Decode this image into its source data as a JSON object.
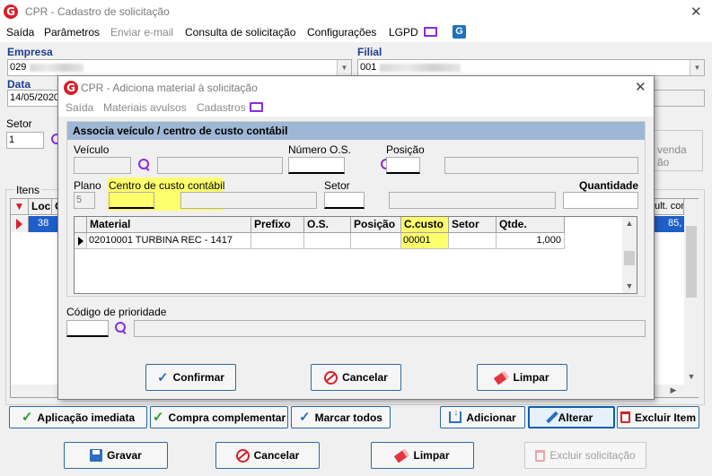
{
  "window": {
    "title": "CPR - Cadastro de solicitação",
    "close": "✕"
  },
  "menu": {
    "items": [
      {
        "label": "Saída"
      },
      {
        "label": "Parâmetros"
      },
      {
        "label": "Enviar e-mail"
      },
      {
        "label": "Consulta de solicitação"
      },
      {
        "label": "Configurações"
      },
      {
        "label": "LGPD"
      }
    ]
  },
  "main": {
    "empresa_label": "Empresa",
    "empresa_value": "029",
    "filial_label": "Filial",
    "filial_value": "001",
    "data_label": "Data",
    "data_value": "14/05/2020",
    "setor_label": "Setor",
    "setor_value": "1",
    "itens_label": "Itens",
    "grid_headers": [
      "Loc",
      "G",
      "ult. com"
    ],
    "grid_row": {
      "loc": "38",
      "ult": "85,"
    },
    "side_text_1": "venda",
    "side_text_2": "ão"
  },
  "dialog": {
    "title": "CPR - Adiciona material à solicitação",
    "close": "✕",
    "menu": [
      "Saída",
      "Materiais avulsos",
      "Cadastros"
    ],
    "section_title": "Associa veículo / centro de custo contábil",
    "veiculo_label": "Veículo",
    "numero_os_label": "Número O.S.",
    "posicao_label": "Posição",
    "plano_label": "Plano",
    "plano_value": "5",
    "centro_custo_label": "Centro de custo contábil",
    "setor_label": "Setor",
    "quantidade_label": "Quantidade",
    "grid": {
      "headers": [
        "Material",
        "Prefixo",
        "O.S.",
        "Posição",
        "C.custo",
        "Setor",
        "Qtde."
      ],
      "rows": [
        {
          "material": "02010001 TURBINA REC - 1417",
          "prefixo": "",
          "os": "",
          "posicao": "",
          "ccusto": "00001",
          "setor": "",
          "qtde": "1,000"
        }
      ]
    },
    "prioridade_label": "Código de prioridade",
    "buttons": {
      "confirmar": "Confirmar",
      "cancelar": "Cancelar",
      "limpar": "Limpar"
    }
  },
  "bottom_row1": {
    "aplicacao": "Aplicação imediata",
    "compra": "Compra complementar",
    "marcar": "Marcar todos",
    "adicionar": "Adicionar",
    "alterar": "Alterar",
    "excluir_item": "Excluir Item"
  },
  "bottom_row2": {
    "gravar": "Gravar",
    "cancelar": "Cancelar",
    "limpar": "Limpar",
    "excluir_solicitacao": "Excluir solicitação"
  },
  "colors": {
    "highlight": "#ffff6e",
    "accent": "#2c6aa3",
    "brand": "#d81e2a",
    "selection": "#0b5fad"
  }
}
